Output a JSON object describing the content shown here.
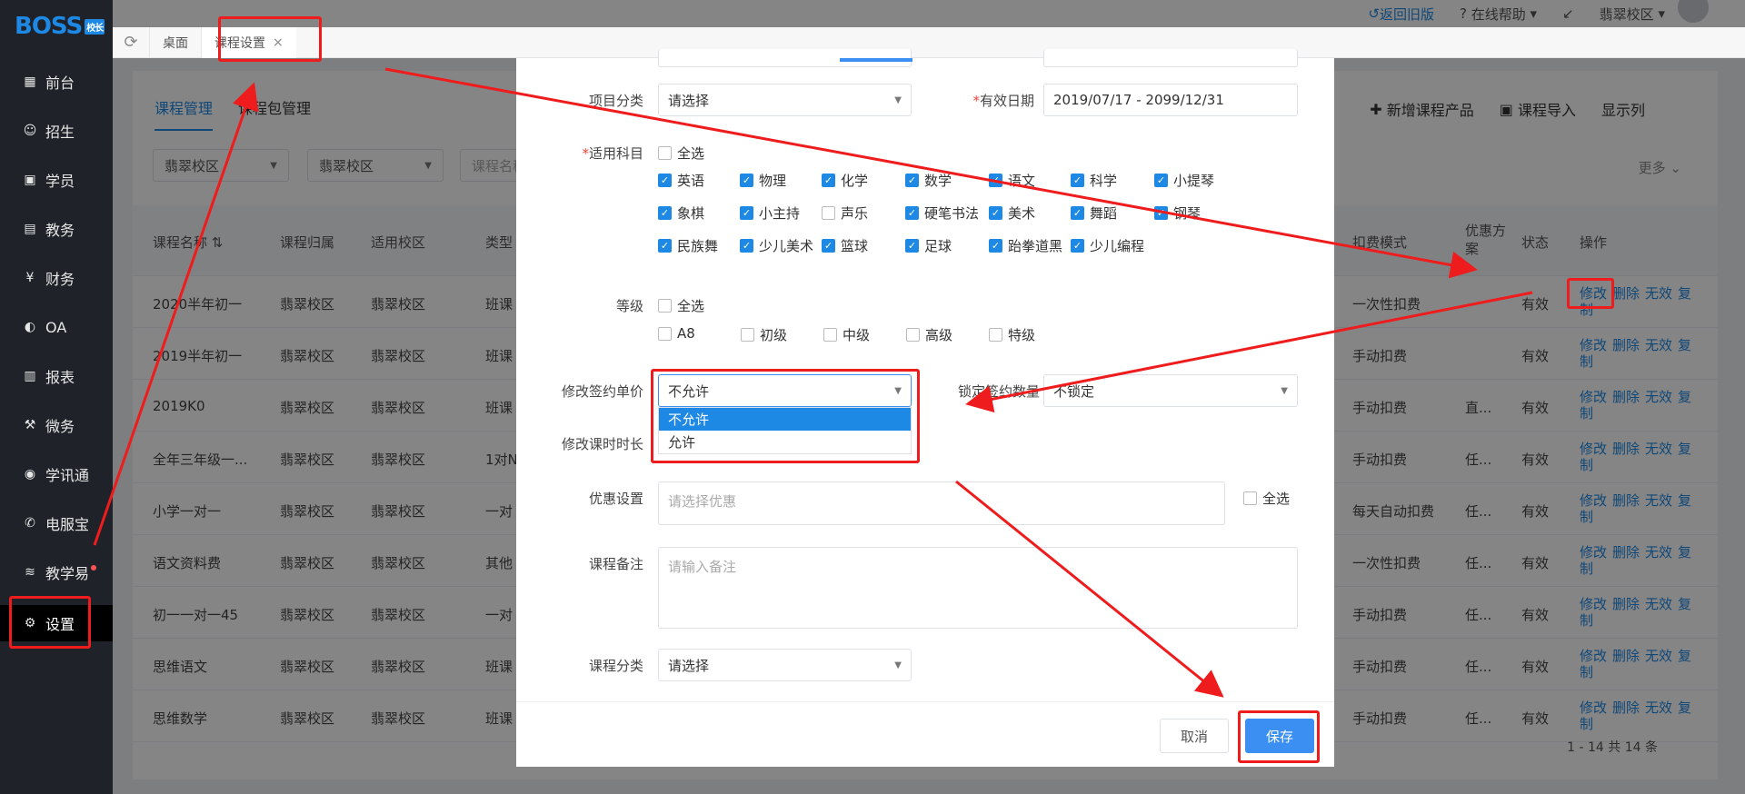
{
  "logo": {
    "text": "BOSS",
    "tag": "校长"
  },
  "sidebar": {
    "items": [
      {
        "label": "前台",
        "icon": "calendar-icon"
      },
      {
        "label": "招生",
        "icon": "user-add-icon"
      },
      {
        "label": "学员",
        "icon": "student-icon"
      },
      {
        "label": "教务",
        "icon": "book-icon"
      },
      {
        "label": "财务",
        "icon": "money-icon"
      },
      {
        "label": "OA",
        "icon": "oa-icon"
      },
      {
        "label": "报表",
        "icon": "chart-icon"
      },
      {
        "label": "微务",
        "icon": "micro-icon"
      },
      {
        "label": "学讯通",
        "icon": "location-icon"
      },
      {
        "label": "电服宝",
        "icon": "phone-icon"
      },
      {
        "label": "教学易",
        "icon": "teach-icon"
      },
      {
        "label": "设置",
        "icon": "gear-icon"
      }
    ]
  },
  "topbar": {
    "back_old": "返回旧版",
    "help": "在线帮助",
    "campus": "翡翠校区"
  },
  "tabbar": {
    "tabs": [
      {
        "label": "桌面"
      },
      {
        "label": "课程设置",
        "close": "×"
      }
    ]
  },
  "main": {
    "tabs": [
      "课程管理",
      "课程包管理"
    ],
    "actions": [
      "新增课程产品",
      "课程导入",
      "显示列"
    ],
    "filters": [
      "翡翠校区",
      "翡翠校区",
      "课程名称"
    ],
    "more": "更多",
    "headers": [
      "课程名称",
      "课程归属",
      "适用校区",
      "类型",
      "扣费模式",
      "优惠方案",
      "状态",
      "操作"
    ],
    "rows": [
      {
        "name": "2020半年初一",
        "owner": "翡翠校区",
        "campus": "翡翠校区",
        "type": "班课",
        "mode": "一次性扣费",
        "promo": "",
        "status": "有效"
      },
      {
        "name": "2019半年初一",
        "owner": "翡翠校区",
        "campus": "翡翠校区",
        "type": "班课",
        "mode": "手动扣费",
        "promo": "",
        "status": "有效"
      },
      {
        "name": "2019K0",
        "owner": "翡翠校区",
        "campus": "翡翠校区",
        "type": "班课",
        "mode": "手动扣费",
        "promo": "直...",
        "status": "有效"
      },
      {
        "name": "全年三年级一...",
        "owner": "翡翠校区",
        "campus": "翡翠校区",
        "type": "1对N",
        "mode": "手动扣费",
        "promo": "任...",
        "status": "有效"
      },
      {
        "name": "小学一对一",
        "owner": "翡翠校区",
        "campus": "翡翠校区",
        "type": "一对",
        "mode": "每天自动扣费",
        "promo": "任...",
        "status": "有效"
      },
      {
        "name": "语文资料费",
        "owner": "翡翠校区",
        "campus": "翡翠校区",
        "type": "其他",
        "mode": "一次性扣费",
        "promo": "任...",
        "status": "有效"
      },
      {
        "name": "初一一对一45",
        "owner": "翡翠校区",
        "campus": "翡翠校区",
        "type": "一对",
        "mode": "手动扣费",
        "promo": "任...",
        "status": "有效"
      },
      {
        "name": "思维语文",
        "owner": "翡翠校区",
        "campus": "翡翠校区",
        "type": "班课",
        "mode": "手动扣费",
        "promo": "任...",
        "status": "有效"
      },
      {
        "name": "思维数学",
        "owner": "翡翠校区",
        "campus": "翡翠校区",
        "type": "班课",
        "mode": "手动扣费",
        "promo": "任...",
        "status": "有效"
      }
    ],
    "ops": {
      "edit": "修改",
      "del": "删除",
      "invalid": "无效",
      "copy1": "复",
      "copy2": "制"
    },
    "pager": "1 - 14   共 14 条"
  },
  "modal": {
    "category_label": "项目分类",
    "category_value": "请选择",
    "valid_label": "有效日期",
    "valid_value": "2019/07/17 - 2099/12/31",
    "subjects_label": "适用科目",
    "all": "全选",
    "subjects": [
      {
        "name": "英语",
        "checked": true
      },
      {
        "name": "物理",
        "checked": true
      },
      {
        "name": "化学",
        "checked": true
      },
      {
        "name": "数学",
        "checked": true
      },
      {
        "name": "语文",
        "checked": true
      },
      {
        "name": "科学",
        "checked": true
      },
      {
        "name": "小提琴",
        "checked": true
      },
      {
        "name": "象棋",
        "checked": true
      },
      {
        "name": "小主持",
        "checked": true
      },
      {
        "name": "声乐",
        "checked": false
      },
      {
        "name": "硬笔书法",
        "checked": true
      },
      {
        "name": "美术",
        "checked": true
      },
      {
        "name": "舞蹈",
        "checked": true
      },
      {
        "name": "钢琴",
        "checked": true
      },
      {
        "name": "民族舞",
        "checked": true
      },
      {
        "name": "少儿美术",
        "checked": true
      },
      {
        "name": "篮球",
        "checked": true
      },
      {
        "name": "足球",
        "checked": true
      },
      {
        "name": "跆拳道黑",
        "checked": true
      },
      {
        "name": "少儿编程",
        "checked": true
      }
    ],
    "level_label": "等级",
    "levels": [
      "A8",
      "初级",
      "中级",
      "高级",
      "特级"
    ],
    "price_label": "修改签约单价",
    "price_value": "不允许",
    "price_options": [
      "不允许",
      "允许"
    ],
    "lock_label": "锁定签约数量",
    "lock_value": "不锁定",
    "duration_label": "修改课时时长",
    "promo_label": "优惠设置",
    "promo_placeholder": "请选择优惠",
    "note_label": "课程备注",
    "note_placeholder": "请输入备注",
    "course_cat_label": "课程分类",
    "course_cat_value": "请选择",
    "cancel": "取消",
    "save": "保存"
  },
  "colors": {
    "primary": "#1e88e5",
    "annotation": "#ee1c1c",
    "sidebar": "#1f2329"
  }
}
